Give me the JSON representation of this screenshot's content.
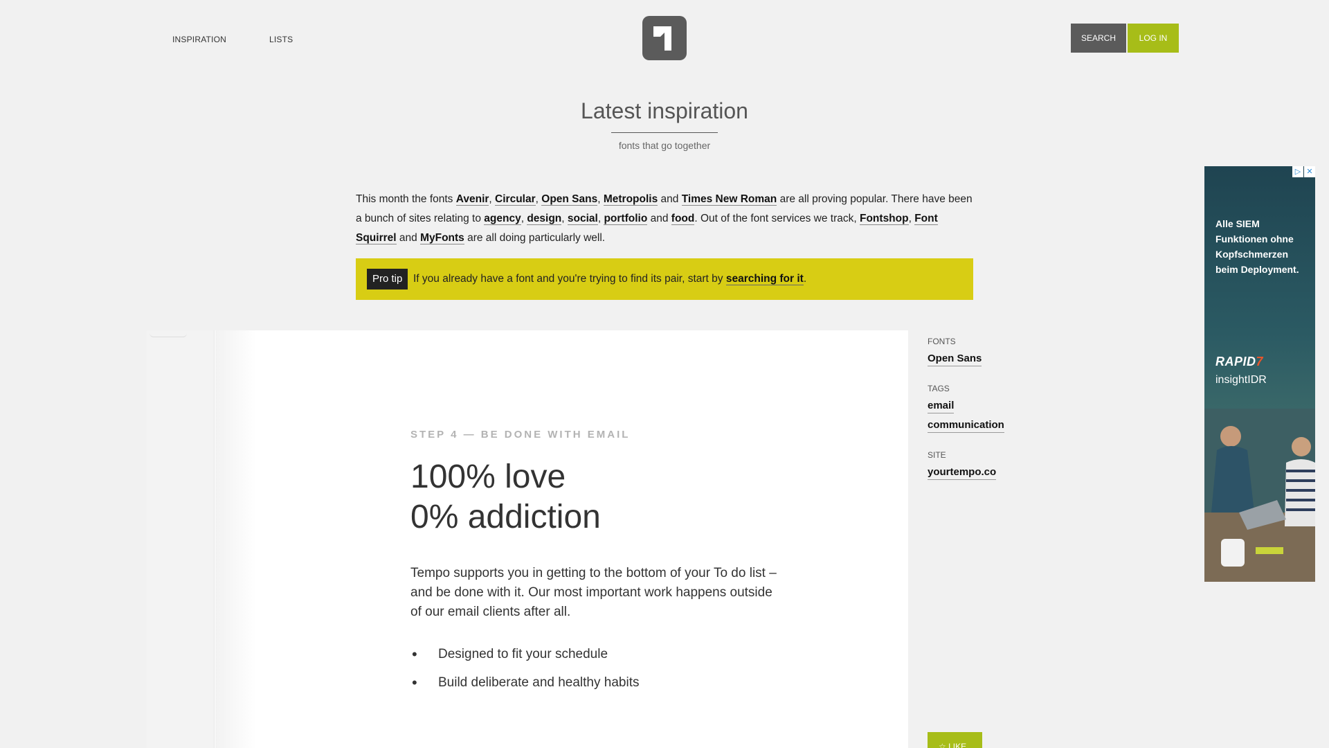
{
  "header": {
    "nav": [
      "INSPIRATION",
      "LISTS"
    ],
    "search_label": "SEARCH",
    "login_label": "LOG IN",
    "logo_icon": "typeface-logo-icon"
  },
  "heading": {
    "title": "Latest inspiration",
    "subtitle": "fonts that go together"
  },
  "intro": {
    "t1": "This month the fonts ",
    "fonts": [
      "Avenir",
      "Circular",
      "Open Sans",
      "Metropolis",
      "Times New Roman"
    ],
    "t2": " are all proving popular. There have been a bunch of sites relating to ",
    "tags": [
      "agency",
      "design",
      "social",
      "portfolio",
      "food"
    ],
    "t3": ". Out of the font services we track, ",
    "services": [
      "Fontshop",
      "Font Squirrel",
      "MyFonts"
    ],
    "t4": " are all doing particularly well.",
    "sep_comma": ", ",
    "sep_and": " and "
  },
  "protip": {
    "badge": "Pro tip",
    "text": "If you already have a font and you're trying to find its pair, start by ",
    "link": "searching for it",
    "end": "."
  },
  "preview": {
    "step": "STEP 4 — BE DONE WITH EMAIL",
    "headline_line1": "100% love",
    "headline_line2": "0% addiction",
    "body": "Tempo supports you in getting to the bottom of your To do list – and be done with it. Our most important work happens outside of our email clients after all.",
    "bullets": [
      "Designed to fit your schedule",
      "Build deliberate and healthy habits"
    ]
  },
  "meta": {
    "fonts_label": "FONTS",
    "fonts": [
      "Open Sans"
    ],
    "tags_label": "TAGS",
    "tags": [
      "email",
      "communication"
    ],
    "site_label": "SITE",
    "site": "yourtempo.co",
    "like_label": "LIKE",
    "like_icon": "star-icon"
  },
  "ad": {
    "headline": "Alle SIEM Funktionen ohne Kopfschmerzen beim Deployment.",
    "brand": "RAPID",
    "brand_mark": "7",
    "product": "insightIDR",
    "info_icon": "adchoices-icon",
    "close_icon": "close-icon"
  },
  "colors": {
    "accent_green": "#a7bd18",
    "protip_yellow": "#d8cd14",
    "dark_gray": "#5b5b5b"
  }
}
